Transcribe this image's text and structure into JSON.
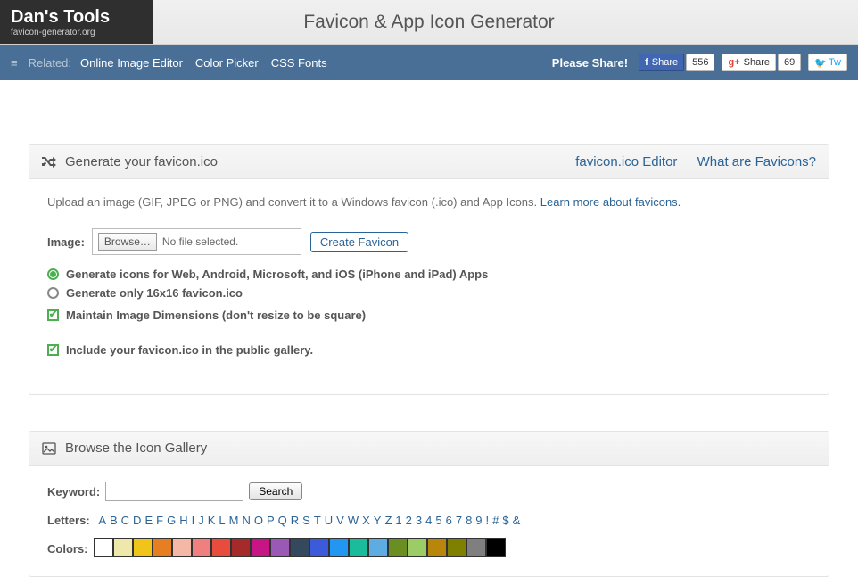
{
  "header": {
    "logo_title": "Dan's Tools",
    "logo_sub": "favicon-generator.org",
    "page_title": "Favicon & App Icon Generator"
  },
  "nav": {
    "related_label": "Related:",
    "links": [
      "Online Image Editor",
      "Color Picker",
      "CSS Fonts"
    ],
    "please_share": "Please Share!",
    "fb_label": "Share",
    "fb_count": "556",
    "gp_label": "Share",
    "gp_count": "69",
    "tw_label": "Tw"
  },
  "panel1": {
    "title": "Generate your favicon.ico",
    "link_editor": "favicon.ico Editor",
    "link_whatare": "What are Favicons?",
    "intro_text": "Upload an image (GIF, JPEG or PNG) and convert it to a Windows favicon (.ico) and App Icons. ",
    "intro_link": "Learn more about favicons.",
    "image_label": "Image:",
    "browse_label": "Browse…",
    "no_file": "No file selected.",
    "create_btn": "Create Favicon",
    "opt_full": "Generate icons for Web, Android, Microsoft, and iOS (iPhone and iPad) Apps",
    "opt_16": "Generate only 16x16 favicon.ico",
    "opt_maintain": "Maintain Image Dimensions (don't resize to be square)",
    "opt_include": "Include your favicon.ico in the public gallery."
  },
  "panel2": {
    "title": "Browse the Icon Gallery",
    "keyword_label": "Keyword:",
    "search_btn": "Search",
    "letters_label": "Letters:",
    "letters": [
      "A",
      "B",
      "C",
      "D",
      "E",
      "F",
      "G",
      "H",
      "I",
      "J",
      "K",
      "L",
      "M",
      "N",
      "O",
      "P",
      "Q",
      "R",
      "S",
      "T",
      "U",
      "V",
      "W",
      "X",
      "Y",
      "Z",
      "1",
      "2",
      "3",
      "4",
      "5",
      "6",
      "7",
      "8",
      "9",
      "!",
      "#",
      "$",
      "&"
    ],
    "colors_label": "Colors:",
    "colors": [
      "#ffffff",
      "#eee8aa",
      "#f0c419",
      "#e67e22",
      "#f5b7a6",
      "#f08080",
      "#e74c3c",
      "#a52a2a",
      "#c71585",
      "#9b59b6",
      "#34495e",
      "#3b5bdb",
      "#2196f3",
      "#1abc9c",
      "#5dade2",
      "#6b8e23",
      "#9ccc65",
      "#b8860b",
      "#808000",
      "#7f7f7f",
      "#000000"
    ]
  }
}
